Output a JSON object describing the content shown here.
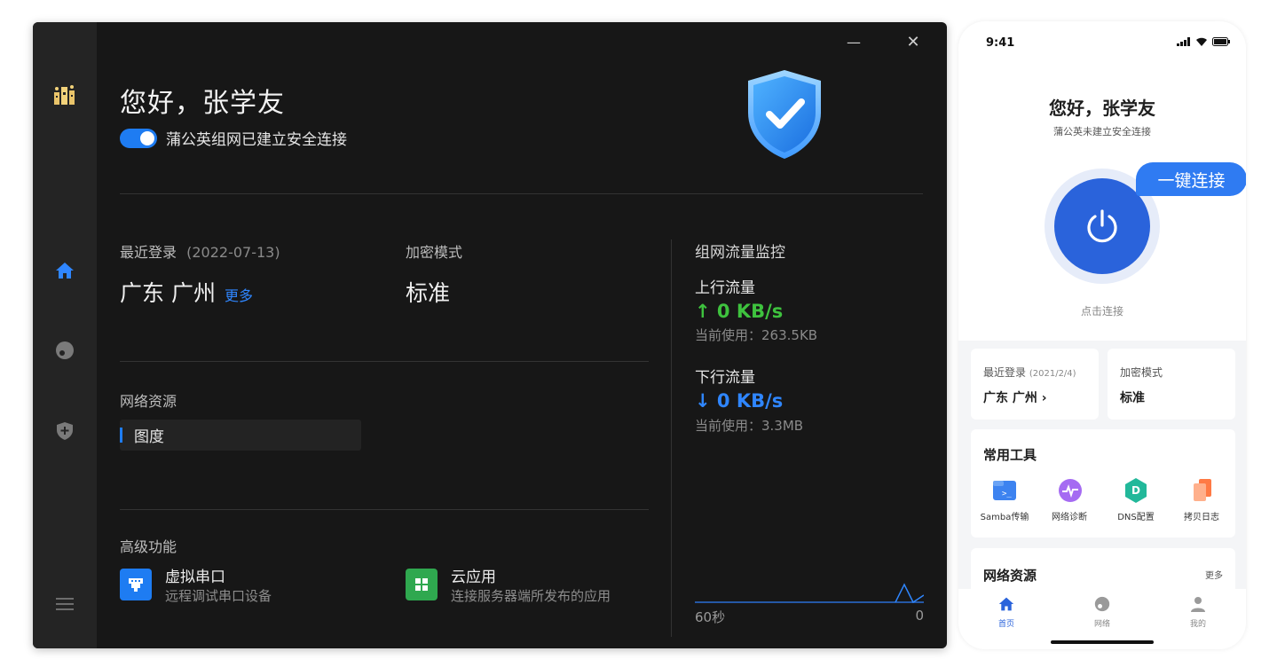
{
  "desktop": {
    "window_controls": {
      "minimize": "—",
      "close": "✕"
    },
    "greeting": "您好，张学友",
    "status": "蒲公英组网已建立安全连接",
    "toggle_on": true,
    "login": {
      "label": "最近登录",
      "date": "(2022-07-13)",
      "location": "广东 广州",
      "more": "更多"
    },
    "encryption": {
      "label": "加密模式",
      "value": "标准"
    },
    "resources": {
      "title": "网络资源",
      "items": [
        "图度"
      ]
    },
    "advanced": {
      "title": "高级功能",
      "items": [
        {
          "title": "虚拟串口",
          "subtitle": "远程调试串口设备",
          "icon": "serial-port-icon",
          "color": "#1e7cf2"
        },
        {
          "title": "云应用",
          "subtitle": "连接服务器端所发布的应用",
          "icon": "app-grid-icon",
          "color": "#2fa84f"
        }
      ]
    },
    "traffic": {
      "title": "组网流量监控",
      "up": {
        "label": "上行流量",
        "value": "↑ 0 KB/s",
        "usage": "当前使用：263.5KB",
        "color": "#3ec23e"
      },
      "down": {
        "label": "下行流量",
        "value": "↓ 0 KB/s",
        "usage": "当前使用：3.3MB",
        "color": "#2f86ff"
      },
      "chart": {
        "x_label": "60秒",
        "y_label": "0"
      }
    },
    "sidebar": {
      "icons": [
        "logo-icon",
        "home-icon",
        "network-icon",
        "shield-plus-icon",
        "menu-icon"
      ]
    }
  },
  "phone": {
    "time": "9:41",
    "greeting": "您好，张学友",
    "status": "蒲公英未建立安全连接",
    "connect_bubble": "一键连接",
    "click_connect": "点击连接",
    "login": {
      "label": "最近登录",
      "date": "(2021/2/4)",
      "location": "广东 广州 ›"
    },
    "encryption": {
      "label": "加密模式",
      "value": "标准"
    },
    "tools": {
      "title": "常用工具",
      "items": [
        "Samba传输",
        "网络诊断",
        "DNS配置",
        "拷贝日志"
      ]
    },
    "resources": {
      "title": "网络资源",
      "more": "更多"
    },
    "tabs": [
      "首页",
      "网络",
      "我的"
    ]
  }
}
